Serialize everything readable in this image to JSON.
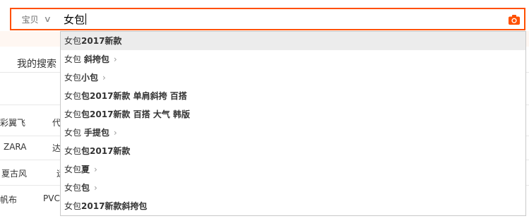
{
  "search": {
    "scope_label": "宝贝",
    "query": "女包"
  },
  "background": {
    "my_search_label": "我的搜索",
    "rows": [
      {
        "left": "彩翼飞",
        "mid": "代"
      },
      {
        "left": "ZARA",
        "mid": "达"
      },
      {
        "left": "夏古风",
        "mid": "运"
      },
      {
        "left": "帆布",
        "mid": "PVC"
      }
    ]
  },
  "suggestions": [
    {
      "prefix": "女包",
      "bold": "2017新款",
      "has_arrow": false
    },
    {
      "prefix": "女包 ",
      "bold": "斜挎包",
      "has_arrow": true
    },
    {
      "prefix": "女包",
      "bold": "小包",
      "has_arrow": true
    },
    {
      "prefix": "女包",
      "bold": "包2017新款 单肩斜挎 百搭",
      "has_arrow": false
    },
    {
      "prefix": "女包",
      "bold": "包2017新款 百搭 大气 韩版",
      "has_arrow": false
    },
    {
      "prefix": "女包 ",
      "bold": "手提包",
      "has_arrow": true
    },
    {
      "prefix": "女包",
      "bold": "包2017新款",
      "has_arrow": false
    },
    {
      "prefix": "女包",
      "bold": "夏",
      "has_arrow": true
    },
    {
      "prefix": "女包",
      "bold": "包",
      "has_arrow": true
    },
    {
      "prefix": "女包",
      "bold": "2017新款斜挎包",
      "has_arrow": false
    }
  ],
  "colors": {
    "accent": "#ff5000",
    "highlight": "#ececec"
  },
  "icons": {
    "scope_dropdown": "chevron-down-icon",
    "camera": "camera-icon",
    "suggestion_arrow": "chevron-right-icon"
  }
}
